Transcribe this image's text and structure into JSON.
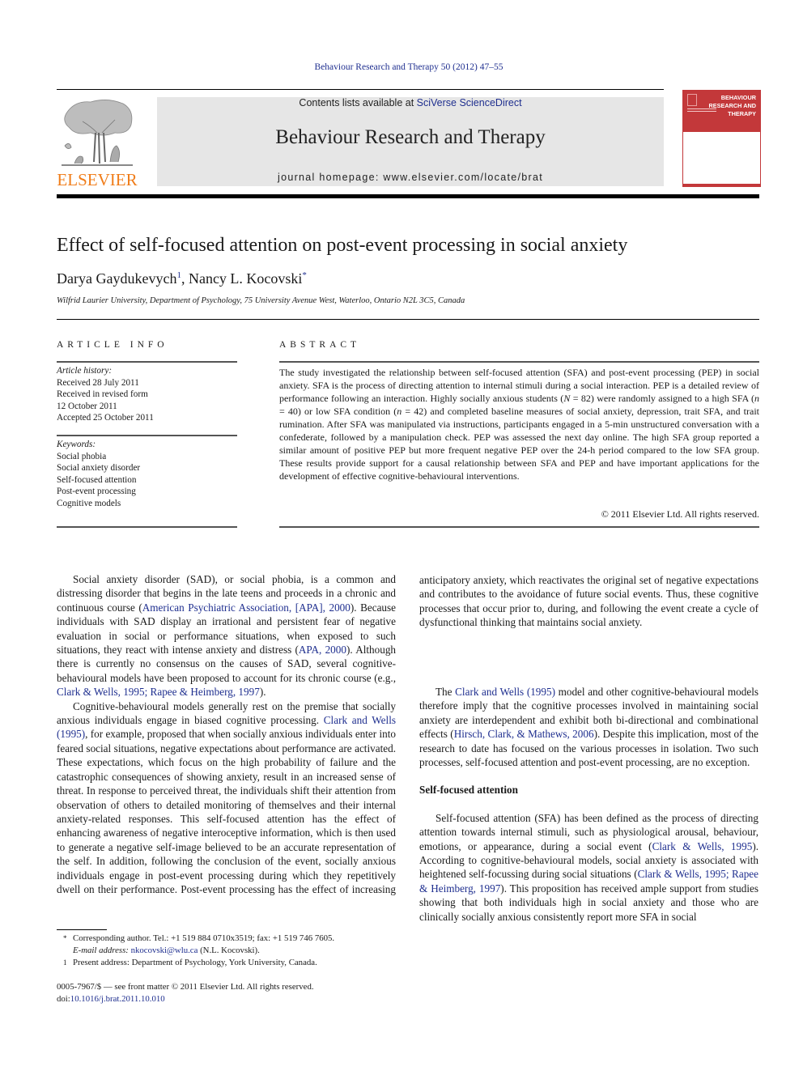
{
  "running_head": "Behaviour Research and Therapy 50 (2012) 47–55",
  "publisher": {
    "name": "ELSEVIER",
    "accent_color": "#f07d1a"
  },
  "banner": {
    "contents_prefix": "Contents lists available at ",
    "contents_link": "SciVerse ScienceDirect",
    "journal_title": "Behaviour Research and Therapy",
    "homepage": "journal homepage: www.elsevier.com/locate/brat"
  },
  "cover": {
    "title_line1": "BEHAVIOUR",
    "title_line2": "RESEARCH AND",
    "title_line3": "THERAPY",
    "color": "#c3383a"
  },
  "article": {
    "title": "Effect of self-focused attention on post-event processing in social anxiety",
    "author1": "Darya Gaydukevych",
    "author1_mark": "1",
    "author_sep": ", ",
    "author2": "Nancy L. Kocovski",
    "author2_mark": "*",
    "affiliation": "Wilfrid Laurier University, Department of Psychology, 75 University Avenue West, Waterloo, Ontario N2L 3C5, Canada"
  },
  "article_info": {
    "heading": "ARTICLE INFO",
    "history_label": "Article history:",
    "history": [
      "Received 28 July 2011",
      "Received in revised form",
      "12 October 2011",
      "Accepted 25 October 2011"
    ],
    "keywords_label": "Keywords:",
    "keywords": [
      "Social phobia",
      "Social anxiety disorder",
      "Self-focused attention",
      "Post-event processing",
      "Cognitive models"
    ]
  },
  "abstract": {
    "heading": "ABSTRACT",
    "text_1": "The study investigated the relationship between self-focused attention (SFA) and post-event processing (PEP) in social anxiety. SFA is the process of directing attention to internal stimuli during a social interaction. PEP is a detailed review of performance following an interaction. Highly socially anxious students (",
    "N": "N",
    "text_2": " = 82) were randomly assigned to a high SFA (",
    "n1": "n",
    "text_3": " = 40) or low SFA condition (",
    "n2": "n",
    "text_4": " = 42) and completed baseline measures of social anxiety, depression, trait SFA, and trait rumination. After SFA was manipulated via instructions, participants engaged in a 5-min unstructured conversation with a confederate, followed by a manipulation check. PEP was assessed the next day online. The high SFA group reported a similar amount of positive PEP but more frequent negative PEP over the 24-h period compared to the low SFA group. These results provide support for a causal relationship between SFA and PEP and have important applications for the development of effective cognitive-behavioural interventions.",
    "copyright": "© 2011 Elsevier Ltd. All rights reserved."
  },
  "body": {
    "p1_a": "Social anxiety disorder (SAD), or social phobia, is a common and distressing disorder that begins in the late teens and proceeds in a chronic and continuous course (",
    "p1_link1": "American Psychiatric Association, [APA], 2000",
    "p1_b": "). Because individuals with SAD display an irrational and persistent fear of negative evaluation in social or performance situations, when exposed to such situations, they react with intense anxiety and distress (",
    "p1_link2": "APA, 2000",
    "p1_c": "). Although there is currently no consensus on the causes of SAD, several cognitive-behavioural models have been proposed to account for its chronic course (e.g., ",
    "p1_link3": "Clark & Wells, 1995; Rapee & Heimberg, 1997",
    "p1_d": ").",
    "p2_a": "Cognitive-behavioural models generally rest on the premise that socially anxious individuals engage in biased cognitive processing. ",
    "p2_link1": "Clark and Wells (1995)",
    "p2_b": ", for example, proposed that when socially anxious individuals enter into feared social situations, negative expectations about performance are activated. These expectations, which focus on the high probability of failure and the catastrophic consequences of showing anxiety, result in an increased sense of threat. In response to perceived threat, the individuals shift their attention from observation of others to detailed monitoring of themselves and their internal anxiety-related responses. This self-focused attention has the effect of enhancing awareness of nega­tive interoceptive information, which is then used to generate a negative self-image believed to be an accurate representation of the self. In addition, following the conclusion of the event, socially anxious individuals engage in post-event processing during which they repetitively dwell on their performance. Post-event processing has the effect of increasing anticipatory anxiety, which reactivates the original set of negative expectations and contributes to the avoidance of future social events. Thus, these cognitive processes that occur prior to, during, and following the event create a cycle of dysfunctional thinking that maintains social anxiety.",
    "p3_a": "The ",
    "p3_link1": "Clark and Wells (1995)",
    "p3_b": " model and other cognitive-behavioural models therefore imply that the cognitive processes involved in maintaining social anxiety are interdependent and exhibit both bi-directional and combinational effects (",
    "p3_link2": "Hirsch, Clark, & Mathews, 2006",
    "p3_c": "). Despite this implication, most of the research to date has focused on the various processes in isolation. Two such processes, self-focused attention and post-event processing, are no exception.",
    "subheading": "Self-focused attention",
    "p4_a": "Self-focused attention (SFA) has been defined as the process of directing attention towards internal stimuli, such as physiological arousal, behaviour, emotions, or appearance, during a social event (",
    "p4_link1": "Clark & Wells, 1995",
    "p4_b": "). According to cognitive-behavioural models, social anxiety is associated with heightened self-focussing during social situations (",
    "p4_link2": "Clark & Wells, 1995; Rapee & Heimberg, 1997",
    "p4_c": "). This proposition has received ample support from studies showing that both individuals high in social anxiety and those who are clinically socially anxious consistently report more SFA in social"
  },
  "footnotes": {
    "star_mark": "*",
    "corresponding": "Corresponding author. Tel.: +1 519 884 0710x3519; fax: +1 519 746 7605.",
    "email_label": "E-mail address:",
    "email": "nkocovski@wlu.ca",
    "email_suffix": " (N.L. Kocovski).",
    "one_mark": "1",
    "present_address": "Present address: Department of Psychology, York University, Canada."
  },
  "front_matter": {
    "issn_line": "0005-7967/$ — see front matter © 2011 Elsevier Ltd. All rights reserved.",
    "doi_label": "doi:",
    "doi": "10.1016/j.brat.2011.10.010"
  }
}
